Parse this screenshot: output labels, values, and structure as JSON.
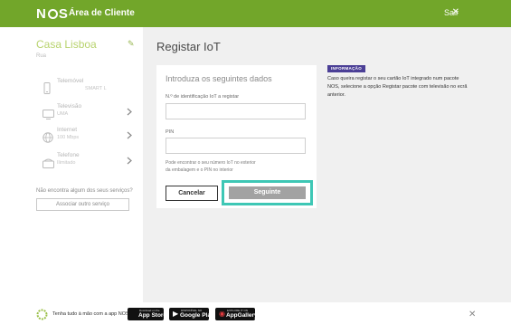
{
  "header": {
    "logo_text": "NOS",
    "title": "Área de Cliente",
    "logout_label": "Sair",
    "logout_icon": "close-icon",
    "color": "#72a62a"
  },
  "sidebar": {
    "account_name": "Casa Lisboa",
    "account_sub": "Rua",
    "edit_icon": "pencil-icon",
    "services": [
      {
        "name": "Telemóvel",
        "detail": "SMART L",
        "icon": "phone-icon"
      },
      {
        "name": "Televisão",
        "detail": "UMA",
        "icon": "tv-icon"
      },
      {
        "name": "Internet",
        "detail": "100 Mbps",
        "icon": "globe-icon"
      },
      {
        "name": "Telefone",
        "detail": "Ilimitado",
        "icon": "landline-icon"
      }
    ],
    "help_text": "Não encontra algum dos seus serviços?",
    "associate_button": "Associar outro serviço"
  },
  "main": {
    "title": "Registar IoT",
    "form": {
      "heading": "Introduza os seguintes dados",
      "iot_label": "N.º de identificação IoT a registar",
      "iot_value": "",
      "pin_label": "PIN",
      "pin_value": "",
      "hint_line1": "Pode encontrar o seu número IoT no exterior",
      "hint_line2": "da embalagem e o PIN no interior",
      "cancel_button": "Cancelar",
      "next_button": "Seguinte"
    },
    "info": {
      "badge": "INFORMAÇÃO",
      "text": "Caso queira registar o seu cartão IoT integrado num pacote NOS, selecione a opção Registar pacote com televisão no ecrã anterior."
    }
  },
  "app_banner": {
    "promo_text": "Tenha tudo à mão com a app NOS",
    "stores": [
      {
        "small": "Download on the",
        "name": "App Store",
        "icon": "apple-icon"
      },
      {
        "small": "DISPONÍVEL NO",
        "name": "Google Play",
        "icon": "google-play-icon"
      },
      {
        "small": "EXPLORE IT ON",
        "name": "AppGallery",
        "icon": "huawei-icon"
      }
    ],
    "close_icon": "close-icon"
  },
  "colors": {
    "brand_green": "#72a62a",
    "highlight_teal": "#3ec7b5",
    "info_purple": "#4b3f96",
    "disabled_button": "#a2a2a2"
  }
}
